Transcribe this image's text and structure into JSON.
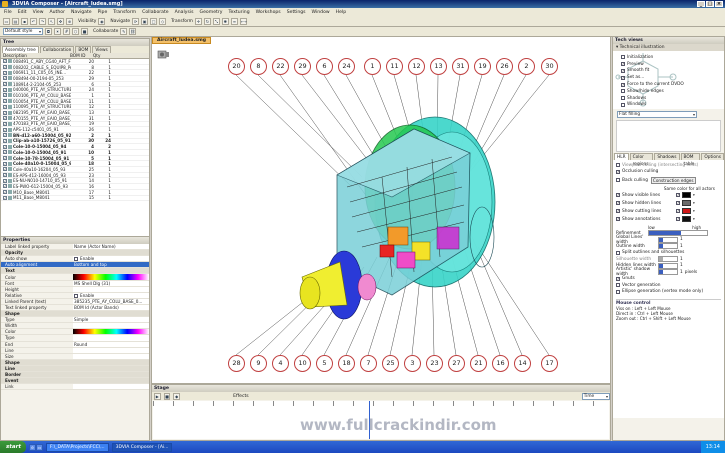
{
  "window": {
    "title": "3DVIA Composer - [Aircraft_Iudea.smg]"
  },
  "menu": [
    "File",
    "Edit",
    "View",
    "Author",
    "Navigate",
    "Pipe",
    "Transform",
    "Collaborate",
    "Analysis",
    "Geometry",
    "Texturing",
    "Workshops",
    "Settings",
    "Window",
    "Help"
  ],
  "toolbar": {
    "mode_combo": "Default style",
    "visibility_label": "Visibility",
    "navigate_label": "Navigate",
    "transform_label": "Transform",
    "collaborate_label": "Collaborate"
  },
  "left_panel": {
    "header": "Tree",
    "tabs": [
      "Assembly tree",
      "Collaboration",
      "BOM",
      "Views"
    ],
    "columns": [
      "Description",
      "BOM ID",
      "Qty"
    ],
    "rows": [
      {
        "desc": "008491_C_ABY_CG40_AFT_FR...",
        "id": "20",
        "qty": "1"
      },
      {
        "desc": "008202_CABLE_S_EQUIP8_PAT...",
        "id": "8",
        "qty": "1"
      },
      {
        "desc": "006911_11_C05_05_INE...",
        "id": "22",
        "qty": "1"
      },
      {
        "desc": "008494-00-2194-05_253",
        "id": "29",
        "qty": "1"
      },
      {
        "desc": "108914-2-2104-05_253",
        "id": "6",
        "qty": "1"
      },
      {
        "desc": "040006_PTE_AY_STRUCTURE...",
        "id": "24",
        "qty": "1"
      },
      {
        "desc": "010106_PTE_AY_COLU_BASE_0...",
        "id": "1",
        "qty": "1"
      },
      {
        "desc": "010054_PTE_AY_COLU_BASE...",
        "id": "11",
        "qty": "1"
      },
      {
        "desc": "110095_PTE_AY_STRUCTURE...",
        "id": "12",
        "qty": "1"
      },
      {
        "desc": "082195_PTE_AY_EAIO_BASE_0...",
        "id": "13",
        "qty": "1"
      },
      {
        "desc": "470155_PTE_AY_EAIO_BASE_0...",
        "id": "31",
        "qty": "1"
      },
      {
        "desc": "470183_PTE_AY_EAIO_BASE_0...",
        "id": "19",
        "qty": "1"
      },
      {
        "desc": "APS-112-c5401_05_91",
        "id": "26",
        "qty": "1"
      },
      {
        "desc": "BN-d12-a60-15004_05_92",
        "id": "2",
        "qty": "1"
      },
      {
        "desc": "Clip-ab-a10-15726_05_91",
        "id": "30",
        "qty": "24"
      },
      {
        "desc": "Cole-10-0-15004_05_94",
        "id": "4",
        "qty": "2"
      },
      {
        "desc": "Cole-10-0-15004_05_91",
        "id": "10",
        "qty": "1"
      },
      {
        "desc": "Cole-10-78-15004_05_91",
        "id": "5",
        "qty": "1"
      },
      {
        "desc": "Cole-40a10-0-15004_05_91",
        "id": "18",
        "qty": "1"
      },
      {
        "desc": "Cole-40a10-16204_05_93",
        "id": "25",
        "qty": "1"
      },
      {
        "desc": "ES-APS-412-16004_05_93",
        "id": "23",
        "qty": "1"
      },
      {
        "desc": "ES-NU-N010-14710_05_91",
        "id": "14",
        "qty": "1"
      },
      {
        "desc": "ES-PWO-612-15004_05_93",
        "id": "16",
        "qty": "1"
      },
      {
        "desc": "M10_Base_M8041",
        "id": "17",
        "qty": "1"
      },
      {
        "desc": "M11_Base_M8041",
        "id": "15",
        "qty": "1"
      }
    ]
  },
  "properties": {
    "header": "Properties",
    "top_combo_key": "Label linked property",
    "top_combo_val": "Name (Actor Name)",
    "rows": [
      {
        "k": "Opacity",
        "v": "",
        "type": "cat"
      },
      {
        "k": "Auto show",
        "v": "Enable",
        "type": "check"
      },
      {
        "k": "Auto alignment",
        "v": "Bottom and top",
        "type": "sel"
      },
      {
        "k": "Text",
        "v": "",
        "type": "cat"
      },
      {
        "k": "Color",
        "v": "",
        "type": "color"
      },
      {
        "k": "Font",
        "v": "MS Shell Dlg (31)",
        "type": "text"
      },
      {
        "k": "Height",
        "v": "",
        "type": "text"
      },
      {
        "k": "Relative",
        "v": "Enable",
        "type": "check"
      },
      {
        "k": "Linked Parent (text)",
        "v": "385235_PTE_AY_COLU_BASE_0...",
        "type": "text"
      },
      {
        "k": "Text linked property",
        "v": "BOM Id (Actor Bands)",
        "type": "text"
      },
      {
        "k": "Shape",
        "v": "",
        "type": "cat"
      },
      {
        "k": "Type",
        "v": "Simple",
        "type": "text"
      },
      {
        "k": "Width",
        "v": "",
        "type": "text"
      },
      {
        "k": "Color",
        "v": "",
        "type": "color"
      },
      {
        "k": "Type",
        "v": "",
        "type": "text"
      },
      {
        "k": "End",
        "v": "Round",
        "type": "text"
      },
      {
        "k": "Line",
        "v": "",
        "type": "text"
      },
      {
        "k": "Size",
        "v": "",
        "type": "text"
      },
      {
        "k": "Shape",
        "v": "",
        "type": "cat"
      },
      {
        "k": "Line",
        "v": "",
        "type": "cat"
      },
      {
        "k": "Border",
        "v": "",
        "type": "cat"
      },
      {
        "k": "Event",
        "v": "",
        "type": "cat"
      },
      {
        "k": "Link",
        "v": "",
        "type": "text"
      }
    ]
  },
  "viewport": {
    "tab": "Aircraft_Iudea.smg",
    "top_bubbles": [
      "20",
      "8",
      "22",
      "29",
      "6",
      "24",
      "1",
      "11",
      "12",
      "13",
      "31",
      "19",
      "26",
      "2",
      "30"
    ],
    "bottom_bubbles": [
      "28",
      "9",
      "4",
      "10",
      "5",
      "18",
      "7",
      "25",
      "3",
      "23",
      "27",
      "21",
      "16",
      "14",
      "17"
    ]
  },
  "stage": {
    "header": "Stage",
    "effects_label": "Effects",
    "time_label": "Time"
  },
  "right_panel": {
    "header": "Tech views",
    "subheader": "Technical illustration",
    "presets": [
      "Initialization",
      "Preview",
      "Smooth fit",
      "Set as...",
      "Force to the current DVDO",
      "Show/hide edges",
      "Shadows",
      "Windows"
    ],
    "combo": "Flat filling",
    "tabs": [
      "HLR",
      "Color regions",
      "Shadows",
      "BOM table",
      "Options"
    ],
    "checks": [
      {
        "label": "Viewport culling (intersecting shits)",
        "on": false
      },
      {
        "label": "Occlusion culling",
        "on": true
      }
    ],
    "culling": {
      "back": "Back culling",
      "construction": "Construction edges"
    },
    "same_color": "Same color for all actors",
    "edge_rows": [
      {
        "label": "Show visible lines",
        "color": "#000000"
      },
      {
        "label": "Show hidden lines",
        "color": "#6a6a6a"
      },
      {
        "label": "Show cutting lines",
        "color": "#d01818"
      },
      {
        "label": "Show annotations",
        "color": "#101010"
      }
    ],
    "refinement": {
      "label": "Refinement",
      "low": "low",
      "high": "high"
    },
    "widths": [
      {
        "label": "Global Lines' width",
        "val": "1"
      },
      {
        "label": "Outline width",
        "val": "1"
      }
    ],
    "split_label": "Split outlines and silhouettes",
    "silhouette_label": "Silhouette width",
    "silhouette_val": "1",
    "hidden_label": "Hidden lines width",
    "hidden_val": "1",
    "artistic": {
      "label": "Artistic' shadow width",
      "val": "1",
      "unit": "pixels"
    },
    "opts": [
      {
        "label": "Gnuts",
        "on": true
      },
      {
        "label": "Vector generation",
        "on": false
      },
      {
        "label": "Ellipse generation (vertex mode only)",
        "on": false
      }
    ],
    "mouse_help": {
      "title": "Mouse control",
      "lines": [
        "Viss on : Left + Left Mouse",
        "Direct in : Ctrl + Left Mouse",
        "Zoom out : Ctrl + Shift + Left Mouse"
      ]
    }
  },
  "taskbar": {
    "start": "start",
    "tasks": [
      "F:\\_DATA\\Projects\\FCC\\...",
      "3DVIA Composer - [Ai..."
    ],
    "clock": "13:14"
  },
  "watermark": "www.fullcrackindir.com"
}
